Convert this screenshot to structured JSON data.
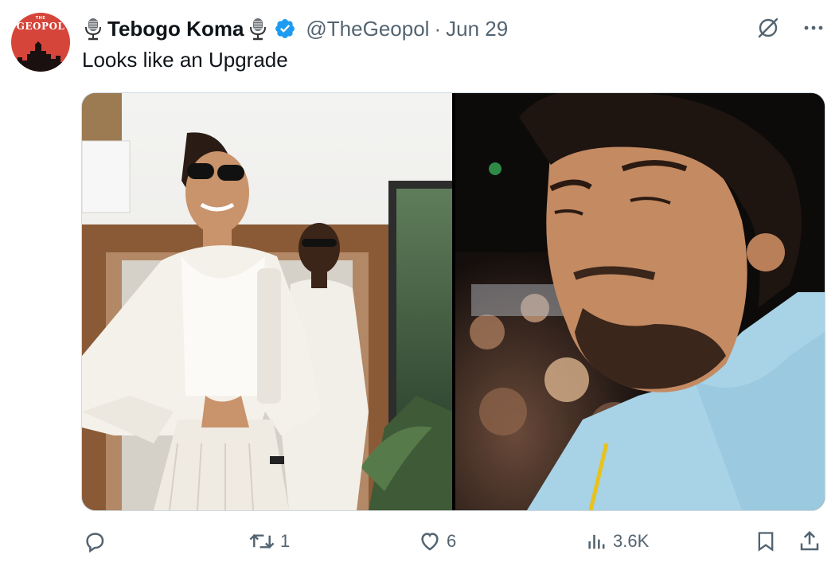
{
  "author": {
    "name": "Tebogo Koma",
    "handle": "@TheGeopol",
    "separator": "·",
    "date": "Jun 29",
    "avatar_logo_text": "GEOPOL",
    "avatar_logo_small": "THE"
  },
  "tweet": {
    "text": "Looks like an Upgrade"
  },
  "media": {
    "left_image": "woman in white outfit with sunglasses, man in white walking behind",
    "right_image": "smiling bearded man with curly hair in light blue hoodie"
  },
  "actions": {
    "reply_count": "",
    "retweet_count": "1",
    "like_count": "6",
    "views_count": "3.6K"
  },
  "colors": {
    "verified": "#1d9bf0",
    "text_primary": "#0f1419",
    "text_secondary": "#536471",
    "avatar_bg": "#d6453a"
  },
  "icons": {
    "top": [
      "grok-icon",
      "more-icon"
    ],
    "actions": [
      "reply-icon",
      "retweet-icon",
      "like-icon",
      "views-icon",
      "bookmark-icon",
      "share-icon"
    ]
  }
}
